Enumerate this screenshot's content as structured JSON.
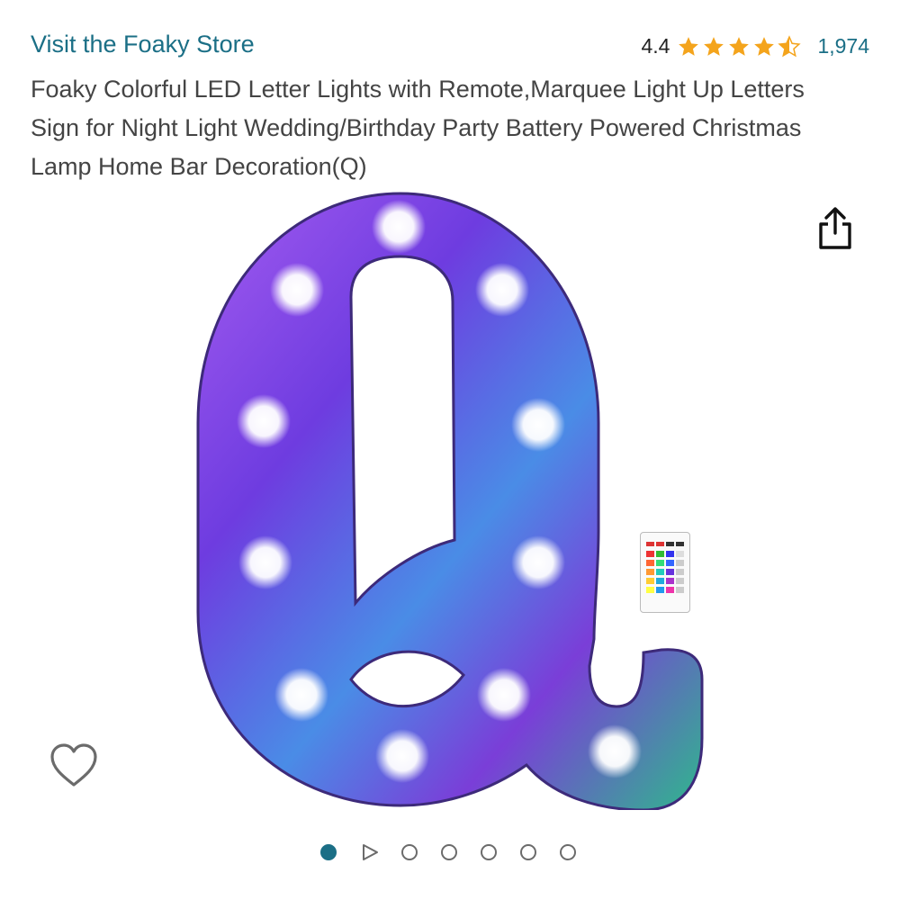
{
  "header": {
    "store_link": "Visit the Foaky Store",
    "rating_value": "4.4",
    "rating_stars": 4.4,
    "rating_count": "1,974"
  },
  "product": {
    "title": "Foaky Colorful LED Letter Lights with Remote,Marquee Light Up Letters Sign for Night Light Wedding/Birthday Party Battery Powered Christmas Lamp Home Bar Decoration(Q)"
  },
  "gallery": {
    "image_count": 7,
    "active_index": 0,
    "video_index": 1
  },
  "icons": {
    "share": "share-icon",
    "wishlist": "heart-icon",
    "star": "star-icon"
  },
  "colors": {
    "link": "#1b6f86",
    "star": "#f4a41c",
    "title": "#444444"
  }
}
